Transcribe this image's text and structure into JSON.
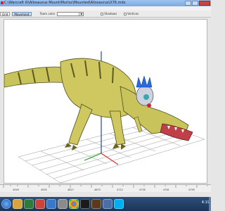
{
  "window": {
    "title": "C:\\Warcraft III\\Allosaurus Mount\\Murloc\\Mounted\\Allosaurus\\X76.mdx",
    "minimize_label": "",
    "maximize_label": "",
    "close_label": ""
  },
  "toolbar": {
    "button_1": "Grid",
    "button_2": "Movement",
    "team_color_label": "Team color",
    "team_color_value": "Red",
    "shadows_label": "Shadows",
    "vertices_label": "Vertices"
  },
  "timeline": {
    "ticks": [
      "4549",
      "4592",
      "4627",
      "4670",
      "4712",
      "4735",
      "4761",
      "4795"
    ]
  },
  "taskbar": {
    "clock": "4:19"
  },
  "colors": {
    "titlebar": "#8fb6ea",
    "viewport_bg": "#ffffff",
    "creature_body": "#c8c35a",
    "creature_stripes": "#5b5a22",
    "axis_red": "#e03030",
    "axis_green": "#2aa02a",
    "axis_blue": "#2a40c8"
  },
  "icons": {
    "title_icon": "app-icon",
    "taskbar": [
      "start-orb-icon",
      "folder-icon",
      "media-icon",
      "app-icon",
      "browser-icon",
      "mail-icon",
      "chrome-icon",
      "steam-icon",
      "game-icon",
      "window-icon",
      "skype-icon"
    ]
  }
}
